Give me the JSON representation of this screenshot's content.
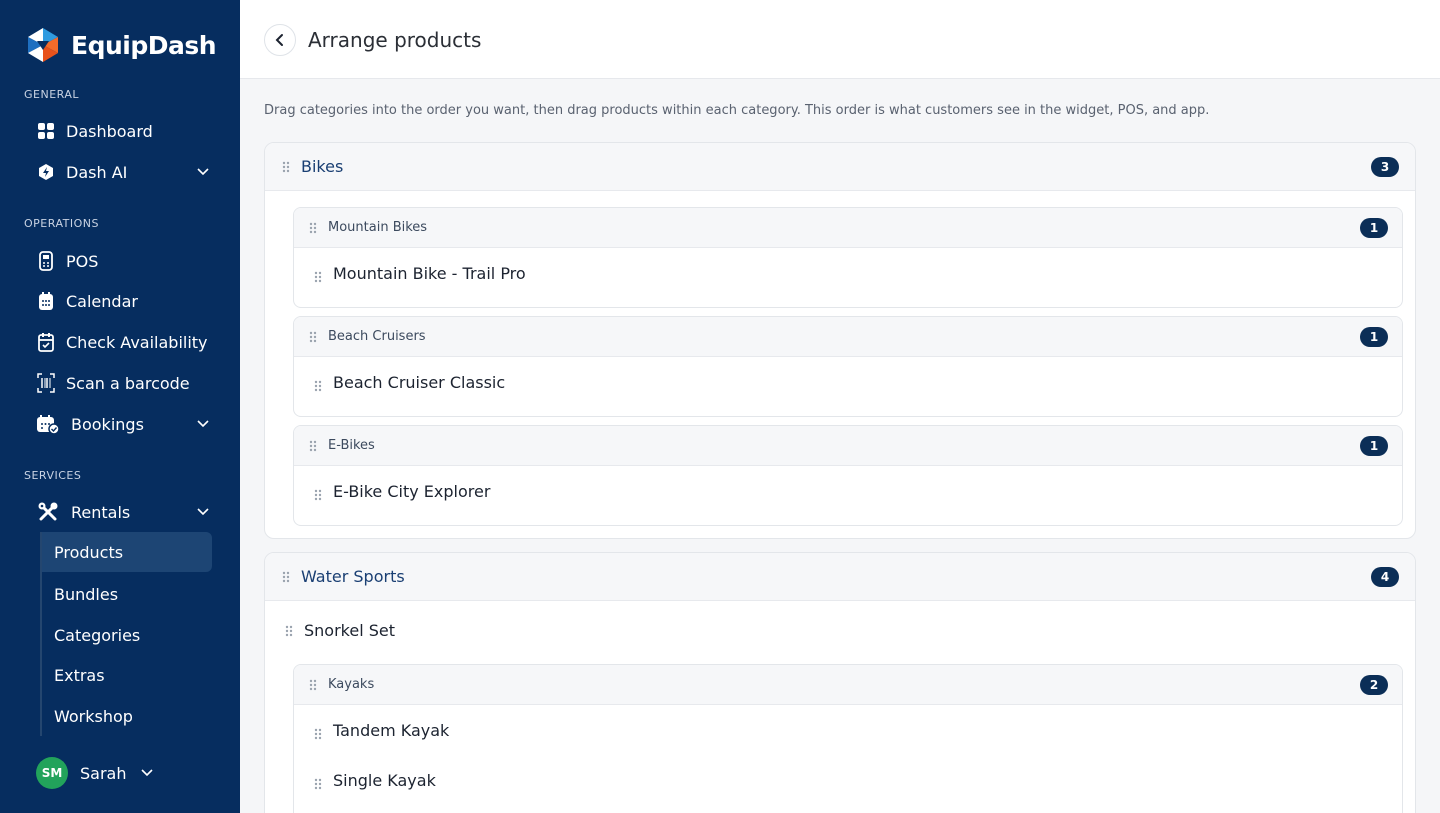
{
  "app": {
    "brand": "EquipDash"
  },
  "sidebar": {
    "sections": {
      "general": "GENERAL",
      "operations": "OPERATIONS",
      "services": "SERVICES"
    },
    "items": {
      "dashboard": "Dashboard",
      "dash_ai": "Dash AI",
      "pos": "POS",
      "calendar": "Calendar",
      "check_availability": "Check Availability",
      "scan_barcode": "Scan a barcode",
      "bookings": "Bookings",
      "rentals": "Rentals"
    },
    "rentals_sub": {
      "products": "Products",
      "bundles": "Bundles",
      "categories": "Categories",
      "extras": "Extras",
      "workshop": "Workshop"
    },
    "user": {
      "initials": "SM",
      "name": "Sarah"
    }
  },
  "header": {
    "title": "Arrange products"
  },
  "intro": "Drag categories into the order you want, then drag products within each category. This order is what customers see in the widget, POS, and app.",
  "categories": [
    {
      "name": "Bikes",
      "count": "3",
      "subcategories": [
        {
          "name": "Mountain Bikes",
          "count": "1",
          "products": [
            "Mountain Bike - Trail Pro"
          ]
        },
        {
          "name": "Beach Cruisers",
          "count": "1",
          "products": [
            "Beach Cruiser Classic"
          ]
        },
        {
          "name": "E-Bikes",
          "count": "1",
          "products": [
            "E-Bike City Explorer"
          ]
        }
      ]
    },
    {
      "name": "Water Sports",
      "count": "4",
      "products": [
        "Snorkel Set"
      ],
      "subcategories": [
        {
          "name": "Kayaks",
          "count": "2",
          "products": [
            "Tandem Kayak",
            "Single Kayak"
          ]
        }
      ]
    }
  ],
  "colors": {
    "sidebar": "#062d5f",
    "badge": "#0b2e57",
    "avatar": "#22a35b",
    "category_title": "#1a3f73"
  }
}
